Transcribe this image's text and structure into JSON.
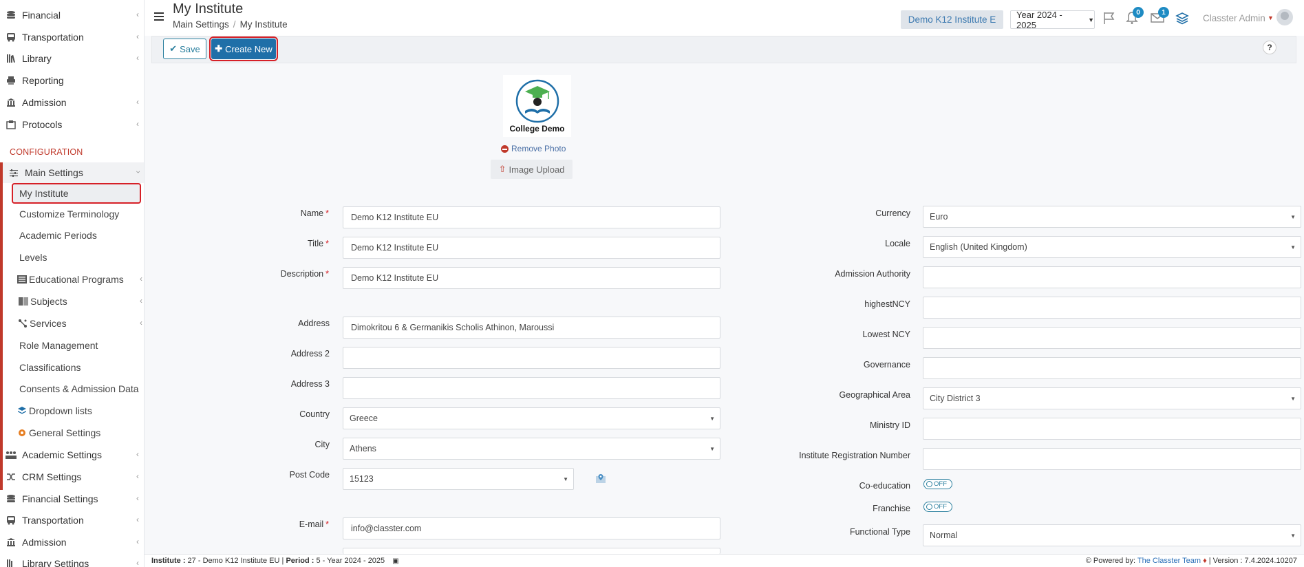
{
  "sidebar": {
    "top_items": [
      {
        "label": "Financial",
        "icon": "coins-icon"
      },
      {
        "label": "Transportation",
        "icon": "bus-icon"
      },
      {
        "label": "Library",
        "icon": "books-icon"
      },
      {
        "label": "Reporting",
        "icon": "printer-icon"
      },
      {
        "label": "Admission",
        "icon": "institution-icon"
      },
      {
        "label": "Protocols",
        "icon": "archive-icon"
      }
    ],
    "config_label": "CONFIGURATION",
    "main_settings": "Main Settings",
    "sub_items": [
      {
        "label": "My Institute"
      },
      {
        "label": "Customize Terminology"
      },
      {
        "label": "Academic Periods"
      },
      {
        "label": "Levels"
      },
      {
        "label": "Educational Programs",
        "icon": "program-icon"
      },
      {
        "label": "Subjects",
        "icon": "book-icon"
      },
      {
        "label": "Services",
        "icon": "services-icon"
      },
      {
        "label": "Role Management"
      },
      {
        "label": "Classifications"
      },
      {
        "label": "Consents & Admission Data"
      },
      {
        "label": "Dropdown lists",
        "icon": "layers-icon"
      },
      {
        "label": "General Settings",
        "icon": "gear-icon"
      }
    ],
    "bottom_items": [
      {
        "label": "Academic Settings",
        "icon": "group-icon"
      },
      {
        "label": "CRM Settings",
        "icon": "shuffle-icon"
      },
      {
        "label": "Financial Settings",
        "icon": "coins-icon"
      },
      {
        "label": "Transportation",
        "icon": "bus-icon"
      },
      {
        "label": "Admission",
        "icon": "institution-icon"
      },
      {
        "label": "Library Settings",
        "icon": "books-icon"
      }
    ]
  },
  "header": {
    "title": "My Institute",
    "breadcrumb": [
      "Main Settings",
      "My Institute"
    ],
    "institute": "Demo K12 Institute E",
    "year": "Year 2024 - 2025",
    "notifications_count": "0",
    "messages_count": "1",
    "user": "Classter Admin"
  },
  "toolbar": {
    "save_label": "Save",
    "create_label": "Create New",
    "help_label": "?"
  },
  "logo": {
    "caption": "College Demo",
    "remove_label": "Remove Photo",
    "upload_label": "Image Upload"
  },
  "form_left": {
    "name": {
      "label": "Name",
      "value": "Demo K12 Institute EU"
    },
    "title": {
      "label": "Title",
      "value": "Demo K12 Institute EU"
    },
    "description": {
      "label": "Description",
      "value": "Demo K12 Institute EU"
    },
    "address": {
      "label": "Address",
      "value": "Dimokritou 6 & Germanikis Scholis Athinon, Maroussi"
    },
    "address2": {
      "label": "Address 2",
      "value": ""
    },
    "address3": {
      "label": "Address 3",
      "value": ""
    },
    "country": {
      "label": "Country",
      "value": "Greece"
    },
    "city": {
      "label": "City",
      "value": "Athens"
    },
    "postcode": {
      "label": "Post Code",
      "value": "15123"
    },
    "email": {
      "label": "E-mail",
      "value": "info@classter.com"
    }
  },
  "form_right": {
    "currency": {
      "label": "Currency",
      "value": "Euro"
    },
    "locale": {
      "label": "Locale",
      "value": "English (United Kingdom)"
    },
    "admission_authority": {
      "label": "Admission Authority",
      "value": ""
    },
    "highest_ncy": {
      "label": "highestNCY",
      "value": ""
    },
    "lowest_ncy": {
      "label": "Lowest NCY",
      "value": ""
    },
    "governance": {
      "label": "Governance",
      "value": ""
    },
    "geo_area": {
      "label": "Geographical Area",
      "value": "City District 3"
    },
    "ministry_id": {
      "label": "Ministry ID",
      "value": ""
    },
    "reg_number": {
      "label": "Institute Registration Number",
      "value": ""
    },
    "coeducation": {
      "label": "Co-education",
      "state": "OFF"
    },
    "franchise": {
      "label": "Franchise",
      "state": "OFF"
    },
    "functional_type": {
      "label": "Functional Type",
      "value": "Normal"
    }
  },
  "footer": {
    "institute_label": "Institute :",
    "institute_value": "27 - Demo K12 Institute EU",
    "period_label": "Period :",
    "period_value": "5 - Year 2024 - 2025",
    "powered_by": "Powered by:",
    "team": "The Classter Team",
    "version": "| Version : 7.4.2024.10207"
  },
  "colors": {
    "accent": "#1f6fa8",
    "config_red": "#c0392b",
    "highlight_red": "#d62027"
  }
}
